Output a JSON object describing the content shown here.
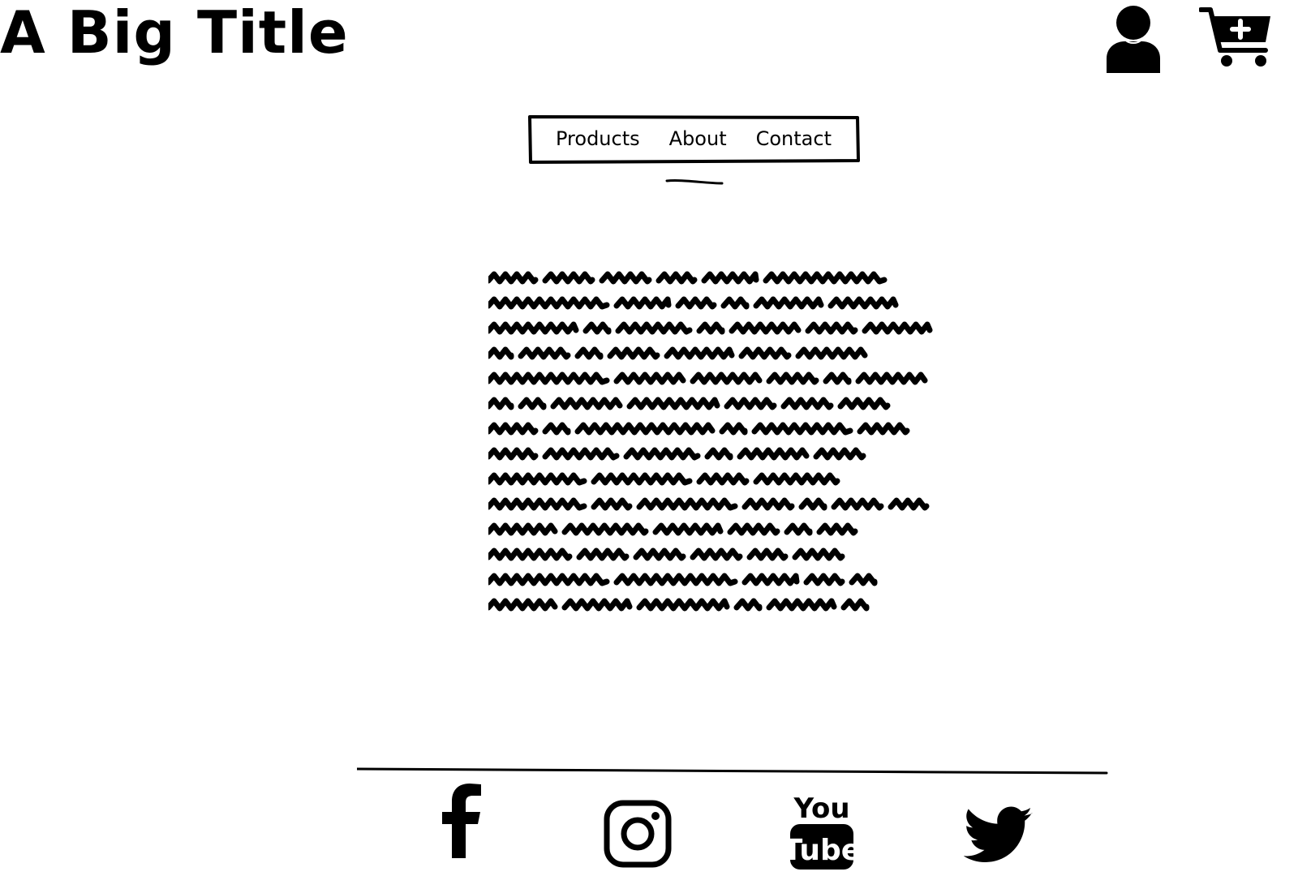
{
  "header": {
    "title": "A Big Title",
    "icons": [
      {
        "name": "user-icon"
      },
      {
        "name": "add-to-cart-icon"
      }
    ]
  },
  "nav": {
    "items": [
      {
        "label": "Products"
      },
      {
        "label": "About"
      },
      {
        "label": "Contact"
      }
    ],
    "active_index": 1
  },
  "main": {
    "body_text_lines": 14
  },
  "footer": {
    "social_icons": [
      {
        "name": "facebook-icon"
      },
      {
        "name": "instagram-icon"
      },
      {
        "name": "youtube-icon",
        "text_top": "You",
        "text_bottom": "Tube"
      },
      {
        "name": "twitter-icon"
      }
    ]
  },
  "colors": {
    "ink": "#000000",
    "background": "#ffffff"
  }
}
